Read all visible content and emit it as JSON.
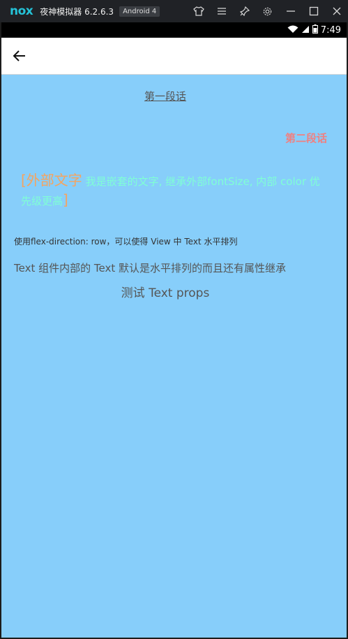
{
  "emulator": {
    "logo": "nox",
    "title": "夜神模拟器 6.2.6.3",
    "android_badge": "Android 4",
    "icons": [
      "shirt-icon",
      "menu-icon",
      "pin-icon",
      "gear-icon",
      "minimize-icon",
      "maximize-icon",
      "close-icon"
    ]
  },
  "statusbar": {
    "time": "7:49",
    "icons": [
      "wifi-icon",
      "signal-icon",
      "battery-icon"
    ]
  },
  "appbar": {
    "back_icon": "arrow-left-icon"
  },
  "content": {
    "paragraph1": "第一段话",
    "paragraph2": "第二段话",
    "outer_open": "[外部文字",
    "inner_text": " 我是嵌套的文字, 继承外部fontSize, 内部 color 优先级更高",
    "outer_close": "]",
    "flex_hint": "使用flex-direction: row，可以使得 View 中 Text 水平排列",
    "row_text": "Text 组件内部的 Text 默认是水平排列的而且还有属性继承",
    "props_text": "测试 Text props"
  },
  "colors": {
    "background": "#87cefa",
    "paragraph2": "#f08080",
    "outer_text": "#f4a460",
    "inner_text": "#7fffd4"
  }
}
